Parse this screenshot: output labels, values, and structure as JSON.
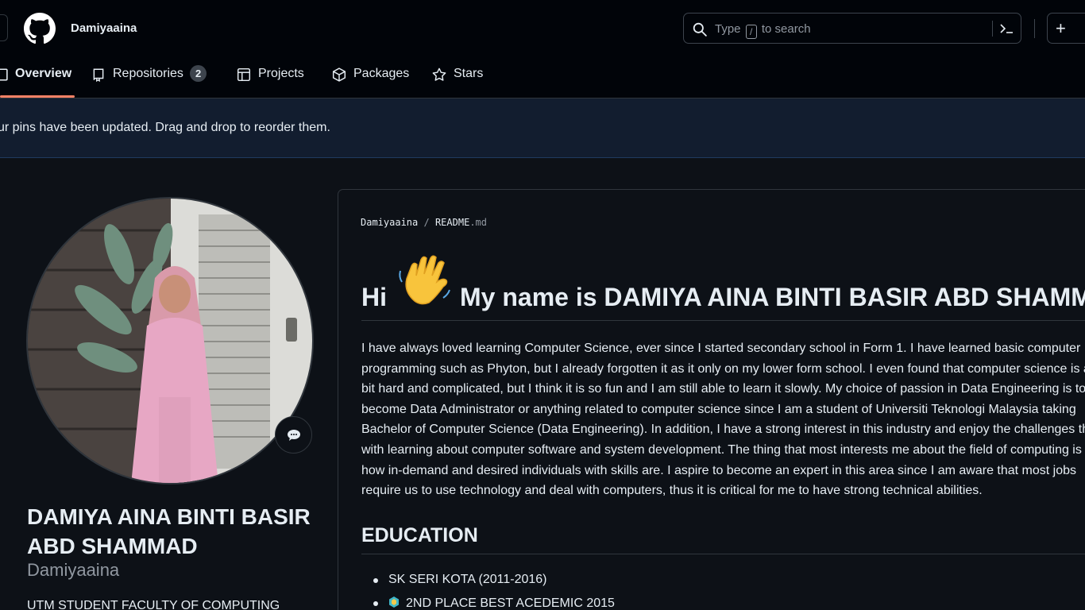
{
  "header": {
    "username": "Damiyaaina",
    "search_placeholder_before": "Type",
    "search_slash": "/",
    "search_placeholder_after": "to search",
    "plus": "+"
  },
  "tabs": [
    {
      "label": "Overview",
      "icon": "book-icon",
      "active": true
    },
    {
      "label": "Repositories",
      "icon": "repo-icon",
      "count": "2"
    },
    {
      "label": "Projects",
      "icon": "table-icon"
    },
    {
      "label": "Packages",
      "icon": "package-icon"
    },
    {
      "label": "Stars",
      "icon": "star-icon"
    }
  ],
  "flash": {
    "message": "ur pins have been updated. Drag and drop to reorder them."
  },
  "profile": {
    "full_name": "DAMIYA AINA BINTI BASIR ABD SHAMMAD",
    "login": "Damiyaaina",
    "bio": "UTM STUDENT FACULTY OF COMPUTING"
  },
  "readme": {
    "owner": "Damiyaaina",
    "separator": "/",
    "file": "README",
    "ext": ".md",
    "heading_hi": "Hi",
    "heading_rest": "My name is DAMIYA AINA BINTI BASIR ABD SHAMMAD",
    "paragraph_lines": [
      "I have always loved learning Computer Science, ever since I started secondary school in Form 1. I have learned basic computer",
      "programming such as Phyton, but I already forgotten it as it only on my lower form school. I even found that computer science is a",
      "bit hard and complicated, but I think it is so fun and I am still able to learn it slowly. My choice of passion in Data Engineering is to",
      "become Data Administrator or anything related to computer science since I am a student of Universiti Teknologi Malaysia taking",
      "Bachelor of Computer Science (Data Engineering). In addition, I have a strong interest in this industry and enjoy the challenges that come",
      "with learning about computer software and system development. The thing that most interests me about the field of computing is",
      "how in-demand and desired individuals with skills are. I aspire to become an expert in this area since I am aware that most jobs",
      "require us to use technology and deal with computers, thus it is critical for me to have strong technical abilities."
    ],
    "education_heading": "EDUCATION",
    "education": [
      {
        "text": "SK SERI KOTA (2011-2016)",
        "icon": ""
      },
      {
        "text": "2ND PLACE BEST ACEDEMIC 2015",
        "icon": "medal-icon"
      }
    ]
  },
  "colors": {
    "accent": "#f78166",
    "bg": "#0d1117",
    "header_bg": "#010409",
    "flash_bg": "#121d2f"
  }
}
